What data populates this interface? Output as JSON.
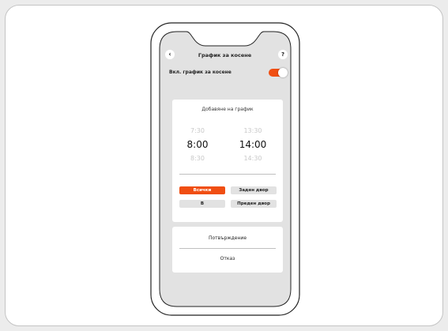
{
  "screen": {
    "title": "График за косене",
    "toggle": {
      "label": "Вкл. график за косене",
      "on": true
    },
    "add_panel": {
      "title": "Добавяне на график",
      "start_times": [
        "7:30",
        "8:00",
        "8:30"
      ],
      "end_times": [
        "13:30",
        "14:00",
        "14:30"
      ],
      "zones": [
        {
          "label": "Всички",
          "active": true
        },
        {
          "label": "Заден двор",
          "active": false
        },
        {
          "label": "В",
          "active": false
        },
        {
          "label": "Преден двор",
          "active": false
        }
      ]
    },
    "actions": {
      "confirm": "Потвърждение",
      "cancel": "Отказ"
    }
  },
  "colors": {
    "accent": "#f04e12",
    "screen_bg": "#e2e2e2",
    "chip_bg": "#e2e2e2"
  },
  "icons": {
    "back": "chevron-left-icon",
    "help": "question-mark-icon"
  }
}
